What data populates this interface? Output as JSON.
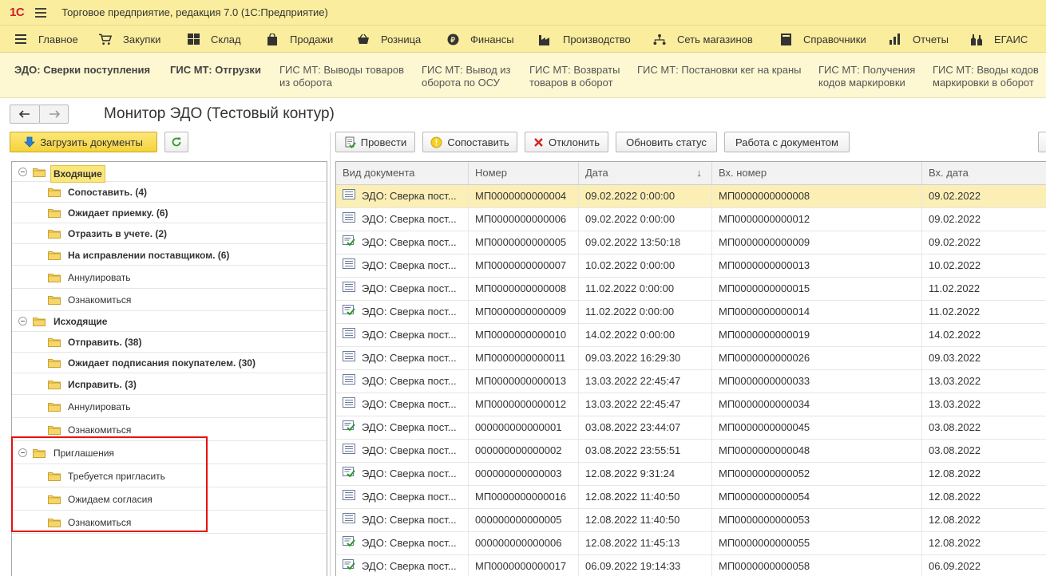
{
  "app": {
    "logo": "1С",
    "title": "Торговое предприятие, редакция 7.0  (1С:Предприятие)"
  },
  "sections": [
    {
      "label": "Главное",
      "icon": "menu-lines-icon"
    },
    {
      "label": "Закупки",
      "icon": "cart-icon"
    },
    {
      "label": "Склад",
      "icon": "warehouse-grid-icon"
    },
    {
      "label": "Продажи",
      "icon": "bag-icon"
    },
    {
      "label": "Розница",
      "icon": "basket-icon"
    },
    {
      "label": "Финансы",
      "icon": "coin-icon"
    },
    {
      "label": "Производство",
      "icon": "factory-icon"
    },
    {
      "label": "Сеть магазинов",
      "icon": "network-icon"
    },
    {
      "label": "Справочники",
      "icon": "book-icon"
    },
    {
      "label": "Отчеты",
      "icon": "chart-icon"
    },
    {
      "label": "ЕГАИС",
      "icon": "bottles-icon"
    }
  ],
  "open_windows": [
    {
      "line1": "ЭДО: Сверки поступления",
      "line2": ""
    },
    {
      "line1": "ГИС МТ: Отгрузки",
      "line2": ""
    },
    {
      "line1": "ГИС МТ: Выводы товаров",
      "line2": "из оборота"
    },
    {
      "line1": "ГИС МТ: Вывод из",
      "line2": "оборота по ОСУ"
    },
    {
      "line1": "ГИС МТ: Возвраты",
      "line2": "товаров в оборот"
    },
    {
      "line1": "ГИС МТ: Постановки кег на краны",
      "line2": ""
    },
    {
      "line1": "ГИС МТ: Получения",
      "line2": "кодов маркировки"
    },
    {
      "line1": "ГИС МТ: Вводы кодов",
      "line2": "маркировки в оборот"
    }
  ],
  "form": {
    "title": "Монитор ЭДО (Тестовый контур)"
  },
  "toolbar_left": {
    "load": "Загрузить документы"
  },
  "toolbar_right": {
    "post": "Провести",
    "match": "Сопоставить",
    "reject": "Отклонить",
    "refresh": "Обновить статус",
    "work": "Работа с документом"
  },
  "tree": [
    {
      "label": "Входящие",
      "level": 0,
      "bold": true,
      "highlight": true
    },
    {
      "label": "Сопоставить. (4)",
      "level": 1,
      "bold": true
    },
    {
      "label": "Ожидает приемку. (6)",
      "level": 1,
      "bold": true
    },
    {
      "label": "Отразить в учете. (2)",
      "level": 1,
      "bold": true
    },
    {
      "label": "На исправлении поставщиком. (6)",
      "level": 1,
      "bold": true
    },
    {
      "label": "Аннулировать",
      "level": 1,
      "bold": false
    },
    {
      "label": "Ознакомиться",
      "level": 1,
      "bold": false
    },
    {
      "label": "Исходящие",
      "level": 0,
      "bold": true
    },
    {
      "label": "Отправить. (38)",
      "level": 1,
      "bold": true
    },
    {
      "label": "Ожидает подписания покупателем. (30)",
      "level": 1,
      "bold": true
    },
    {
      "label": "Исправить. (3)",
      "level": 1,
      "bold": true
    },
    {
      "label": "Аннулировать",
      "level": 1,
      "bold": false
    },
    {
      "label": "Ознакомиться",
      "level": 1,
      "bold": false
    },
    {
      "label": "Приглашения",
      "level": 0,
      "bold": false
    },
    {
      "label": "Требуется пригласить",
      "level": 1,
      "bold": false
    },
    {
      "label": "Ожидаем согласия",
      "level": 1,
      "bold": false
    },
    {
      "label": "Ознакомиться",
      "level": 1,
      "bold": false
    }
  ],
  "table": {
    "columns": [
      "Вид документа",
      "Номер",
      "Дата",
      "Вх. номер",
      "Вх. дата"
    ],
    "sort_indicator": "↓",
    "rows": [
      {
        "icon": "doc",
        "type": "ЭДО: Сверка пост...",
        "num": "МП0000000000004",
        "date": "09.02.2022 0:00:00",
        "innum": "МП0000000000008",
        "indate": "09.02.2022"
      },
      {
        "icon": "doc",
        "type": "ЭДО: Сверка пост...",
        "num": "МП0000000000006",
        "date": "09.02.2022 0:00:00",
        "innum": "МП0000000000012",
        "indate": "09.02.2022"
      },
      {
        "icon": "check",
        "type": "ЭДО: Сверка пост...",
        "num": "МП0000000000005",
        "date": "09.02.2022 13:50:18",
        "innum": "МП0000000000009",
        "indate": "09.02.2022"
      },
      {
        "icon": "doc",
        "type": "ЭДО: Сверка пост...",
        "num": "МП0000000000007",
        "date": "10.02.2022 0:00:00",
        "innum": "МП0000000000013",
        "indate": "10.02.2022"
      },
      {
        "icon": "doc",
        "type": "ЭДО: Сверка пост...",
        "num": "МП0000000000008",
        "date": "11.02.2022 0:00:00",
        "innum": "МП0000000000015",
        "indate": "11.02.2022"
      },
      {
        "icon": "check",
        "type": "ЭДО: Сверка пост...",
        "num": "МП0000000000009",
        "date": "11.02.2022 0:00:00",
        "innum": "МП0000000000014",
        "indate": "11.02.2022"
      },
      {
        "icon": "doc",
        "type": "ЭДО: Сверка пост...",
        "num": "МП0000000000010",
        "date": "14.02.2022 0:00:00",
        "innum": "МП0000000000019",
        "indate": "14.02.2022"
      },
      {
        "icon": "doc",
        "type": "ЭДО: Сверка пост...",
        "num": "МП0000000000011",
        "date": "09.03.2022 16:29:30",
        "innum": "МП0000000000026",
        "indate": "09.03.2022"
      },
      {
        "icon": "doc",
        "type": "ЭДО: Сверка пост...",
        "num": "МП0000000000013",
        "date": "13.03.2022 22:45:47",
        "innum": "МП0000000000033",
        "indate": "13.03.2022"
      },
      {
        "icon": "doc",
        "type": "ЭДО: Сверка пост...",
        "num": "МП0000000000012",
        "date": "13.03.2022 22:45:47",
        "innum": "МП0000000000034",
        "indate": "13.03.2022"
      },
      {
        "icon": "check",
        "type": "ЭДО: Сверка пост...",
        "num": "000000000000001",
        "date": "03.08.2022 23:44:07",
        "innum": "МП0000000000045",
        "indate": "03.08.2022"
      },
      {
        "icon": "doc",
        "type": "ЭДО: Сверка пост...",
        "num": "000000000000002",
        "date": "03.08.2022 23:55:51",
        "innum": "МП0000000000048",
        "indate": "03.08.2022"
      },
      {
        "icon": "check",
        "type": "ЭДО: Сверка пост...",
        "num": "000000000000003",
        "date": "12.08.2022 9:31:24",
        "innum": "МП0000000000052",
        "indate": "12.08.2022"
      },
      {
        "icon": "doc",
        "type": "ЭДО: Сверка пост...",
        "num": "МП0000000000016",
        "date": "12.08.2022 11:40:50",
        "innum": "МП0000000000054",
        "indate": "12.08.2022"
      },
      {
        "icon": "doc",
        "type": "ЭДО: Сверка пост...",
        "num": "000000000000005",
        "date": "12.08.2022 11:40:50",
        "innum": "МП0000000000053",
        "indate": "12.08.2022"
      },
      {
        "icon": "check",
        "type": "ЭДО: Сверка пост...",
        "num": "000000000000006",
        "date": "12.08.2022 11:45:13",
        "innum": "МП0000000000055",
        "indate": "12.08.2022"
      },
      {
        "icon": "check",
        "type": "ЭДО: Сверка пост...",
        "num": "МП0000000000017",
        "date": "06.09.2022 19:14:33",
        "innum": "МП0000000000058",
        "indate": "06.09.2022"
      }
    ]
  }
}
